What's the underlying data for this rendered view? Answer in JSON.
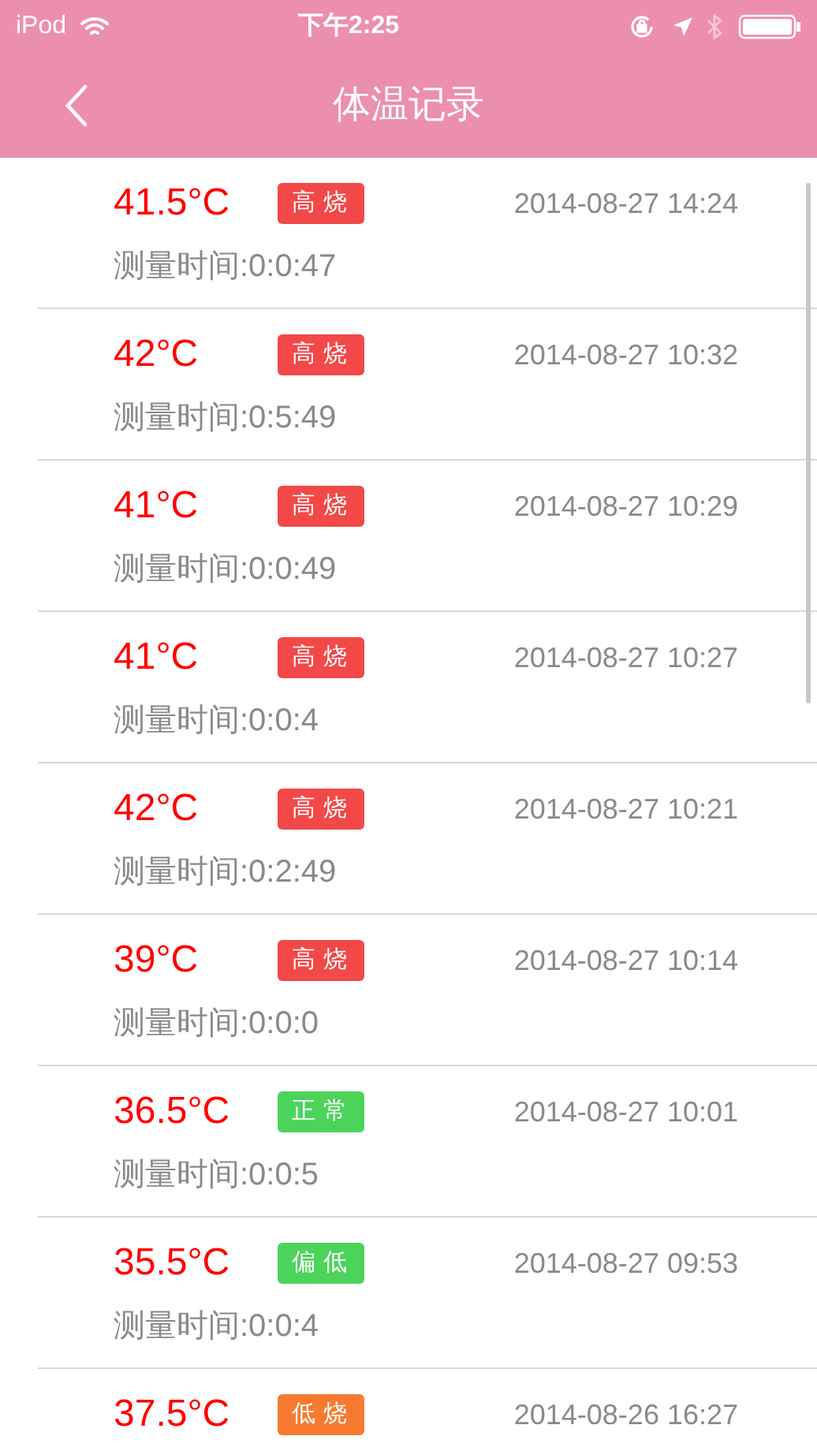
{
  "status_bar": {
    "carrier": "iPod",
    "time": "下午2:25"
  },
  "nav": {
    "title": "体温记录"
  },
  "records": [
    {
      "temperature": "41.5°C",
      "tag": "高烧",
      "color": "#f24848",
      "datetime": "2014-08-27 14:24",
      "duration": "测量时间:0:0:47"
    },
    {
      "temperature": "42°C",
      "tag": "高烧",
      "color": "#f24848",
      "datetime": "2014-08-27 10:32",
      "duration": "测量时间:0:5:49"
    },
    {
      "temperature": "41°C",
      "tag": "高烧",
      "color": "#f24848",
      "datetime": "2014-08-27 10:29",
      "duration": "测量时间:0:0:49"
    },
    {
      "temperature": "41°C",
      "tag": "高烧",
      "color": "#f24848",
      "datetime": "2014-08-27 10:27",
      "duration": "测量时间:0:0:4"
    },
    {
      "temperature": "42°C",
      "tag": "高烧",
      "color": "#f24848",
      "datetime": "2014-08-27 10:21",
      "duration": "测量时间:0:2:49"
    },
    {
      "temperature": "39°C",
      "tag": "高烧",
      "color": "#f24848",
      "datetime": "2014-08-27 10:14",
      "duration": "测量时间:0:0:0"
    },
    {
      "temperature": "36.5°C",
      "tag": "正常",
      "color": "#4cd45a",
      "datetime": "2014-08-27 10:01",
      "duration": "测量时间:0:0:5"
    },
    {
      "temperature": "35.5°C",
      "tag": "偏低",
      "color": "#4cd45a",
      "datetime": "2014-08-27 09:53",
      "duration": "测量时间:0:0:4"
    },
    {
      "temperature": "37.5°C",
      "tag": "低烧",
      "color": "#f77a30",
      "datetime": "2014-08-26 16:27"
    }
  ]
}
